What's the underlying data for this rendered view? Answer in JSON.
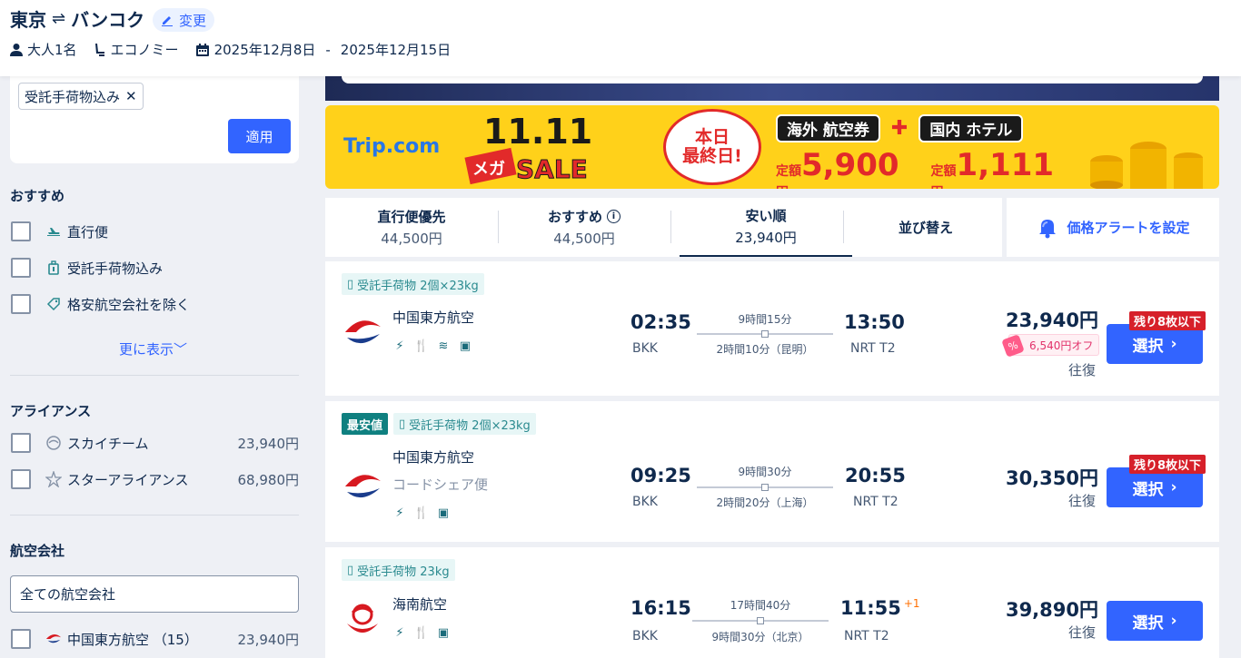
{
  "header": {
    "origin": "東京",
    "swap_symbol": "⇌",
    "destination": "バンコク",
    "change_label": "変更",
    "passengers": "大人1名",
    "cabin": "エコノミー",
    "date_from": "2025年12月8日",
    "date_sep": "-",
    "date_to": "2025年12月15日"
  },
  "filters": {
    "active_chip": "受託手荷物込み",
    "apply_label": "適用",
    "recommend_title": "おすすめ",
    "recommend_items": [
      {
        "label": "直行便",
        "icon": "plane-icon"
      },
      {
        "label": "受託手荷物込み",
        "icon": "luggage-icon"
      },
      {
        "label": "格安航空会社を除く",
        "icon": "tag-icon"
      }
    ],
    "more_label": "更に表示",
    "alliance_title": "アライアンス",
    "alliances": [
      {
        "label": "スカイチーム",
        "price": "23,940円"
      },
      {
        "label": "スターアライアンス",
        "price": "68,980円"
      }
    ],
    "airline_title": "航空会社",
    "airline_select": "全ての航空会社",
    "airlines": [
      {
        "label": "中国東方航空 （15）",
        "price": "23,940円"
      }
    ]
  },
  "banner": {
    "brand": "Trip.com",
    "sale_number": "11.11",
    "sale_mega": "メガ",
    "sale_word": "SALE",
    "badge_line1": "本日",
    "badge_line2": "最終日!",
    "offer1": "海外 航空券",
    "offer2": "国内 ホテル",
    "price1_prefix": "定額",
    "price1": "5,900",
    "price1_suffix": "円〜",
    "price2_prefix": "定額",
    "price2": "1,111",
    "price2_suffix": "円"
  },
  "sort_tabs": [
    {
      "title": "直行便優先",
      "price": "44,500円"
    },
    {
      "title": "おすすめ",
      "price": "44,500円"
    },
    {
      "title": "安い順",
      "price": "23,940円"
    },
    {
      "title": "並び替え",
      "price": ""
    }
  ],
  "price_alert": "価格アラートを設定",
  "flights": [
    {
      "tags": [
        "受託手荷物 2個×23kg"
      ],
      "best": "",
      "airline": "中国東方航空",
      "codeshare": "",
      "dep_time": "02:35",
      "dep_apt": "BKK",
      "duration": "9時間15分",
      "stop": "2時間10分（昆明）",
      "arr_time": "13:50",
      "arr_plus": "",
      "arr_apt": "NRT T2",
      "price": "23,940円",
      "discount": "6,540円オフ",
      "trip_type": "往復",
      "remaining": "残り8枚以下",
      "select": "選択"
    },
    {
      "tags": [
        "受託手荷物 2個×23kg"
      ],
      "best": "最安値",
      "airline": "中国東方航空",
      "codeshare": "コードシェア便",
      "dep_time": "09:25",
      "dep_apt": "BKK",
      "duration": "9時間30分",
      "stop": "2時間20分（上海）",
      "arr_time": "20:55",
      "arr_plus": "",
      "arr_apt": "NRT T2",
      "price": "30,350円",
      "discount": "",
      "trip_type": "往復",
      "remaining": "残り8枚以下",
      "select": "選択"
    },
    {
      "tags": [
        "受託手荷物 23kg"
      ],
      "best": "",
      "airline": "海南航空",
      "codeshare": "",
      "dep_time": "16:15",
      "dep_apt": "BKK",
      "duration": "17時間40分",
      "stop": "9時間30分（北京）",
      "arr_time": "11:55",
      "arr_plus": "+1",
      "arr_apt": "NRT T2",
      "price": "39,890円",
      "discount": "",
      "trip_type": "往復",
      "remaining": "",
      "select": "選択"
    }
  ],
  "colors": {
    "accent": "#3264ff",
    "text": "#0f294d",
    "teal": "#2a8a8f",
    "alert_red": "#d6202a"
  }
}
